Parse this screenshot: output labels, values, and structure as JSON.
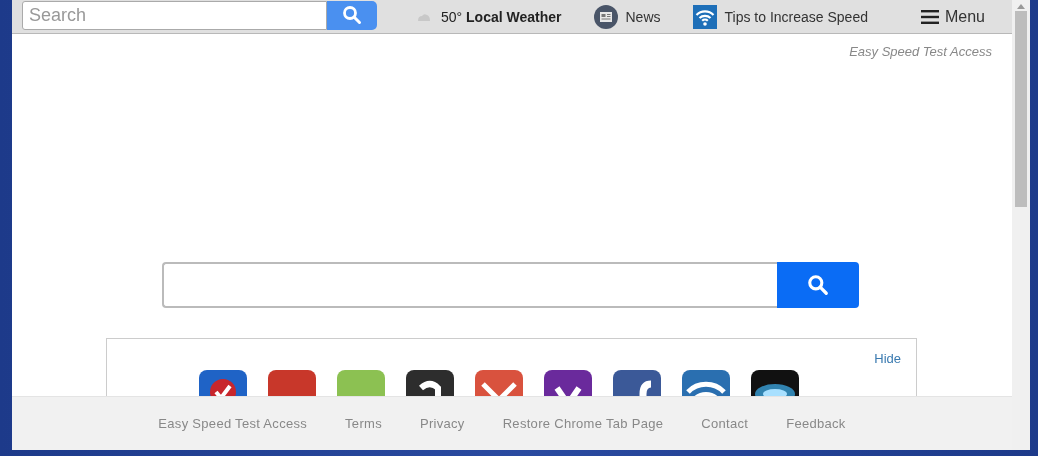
{
  "top_bar": {
    "search": {
      "placeholder": "Search"
    },
    "weather": "50° **Local Weather**",
    "links": [
      {
        "kind": "news",
        "label": "News"
      },
      {
        "kind": "wifi",
        "label": "Tips to Increase Speed"
      }
    ],
    "menu": "Menu"
  },
  "brand": "Easy Speed Test Access",
  "shortcuts": {
    "hide": "Hide",
    "tiles": [
      {
        "kind": "check",
        "color": "#1f63c6"
      },
      {
        "kind": "band",
        "color": "#c8372a"
      },
      {
        "kind": "band",
        "color": "#8cc152"
      },
      {
        "kind": "smile",
        "color": "#2d2d2d"
      },
      {
        "kind": "envelope",
        "color": "#d9523e"
      },
      {
        "kind": "chevron",
        "color": "#6a2a9c"
      },
      {
        "kind": "stem",
        "color": "#3b5998"
      },
      {
        "kind": "wifi",
        "color": "#2a6fb0"
      },
      {
        "kind": "glow",
        "color": "#111111"
      }
    ]
  },
  "footer": [
    "Easy Speed Test Access",
    "Terms",
    "Privacy",
    "Restore Chrome Tab Page",
    "Contact",
    "Feedback"
  ]
}
